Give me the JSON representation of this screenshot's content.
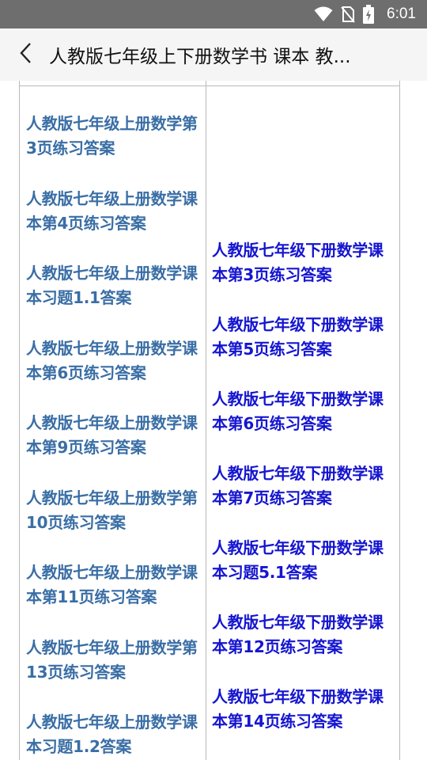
{
  "status_bar": {
    "time": "6:01",
    "icons": [
      "wifi-icon",
      "no-sim-icon",
      "battery-charging-icon"
    ]
  },
  "app_bar": {
    "back_icon": "chevron-left-icon",
    "title": "人教版七年级上下册数学书 课本 教..."
  },
  "colors": {
    "left_link": "#3a6ea5",
    "right_link": "#1515d0",
    "status_bar_bg": "#6e6e6e",
    "app_bar_bg": "#f5f5f5"
  },
  "table": {
    "left_links": [
      "人教版七年级上册数学第3页练习答案",
      "人教版七年级上册数学课本第4页练习答案",
      "人教版七年级上册数学课本习题1.1答案",
      "人教版七年级上册数学课本第6页练习答案",
      "人教版七年级上册数学课本第9页练习答案",
      "人教版七年级上册数学第10页练习答案",
      "人教版七年级上册数学课本第11页练习答案",
      "人教版七年级上册数学第13页练习答案",
      "人教版七年级上册数学课本习题1.2答案"
    ],
    "right_links": [
      "人教版七年级下册数学课本第3页练习答案",
      "人教版七年级下册数学课本第5页练习答案",
      "人教版七年级下册数学课本第6页练习答案",
      "人教版七年级下册数学课本第7页练习答案",
      "人教版七年级下册数学课本习题5.1答案",
      "人教版七年级下册数学课本第12页练习答案",
      "人教版七年级下册数学课本第14页练习答案"
    ]
  }
}
